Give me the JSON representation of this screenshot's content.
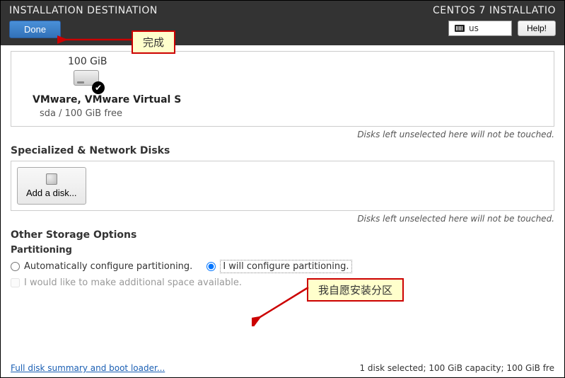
{
  "header": {
    "title": "INSTALLATION DESTINATION",
    "done_label": "Done",
    "installer_title": "CENTOS 7 INSTALLATIO",
    "keyboard_layout": "us",
    "help_label": "Help!"
  },
  "local_disks": {
    "size": "100 GiB",
    "name": "VMware, VMware Virtual S",
    "detail": "sda    /    100 GiB free",
    "note": "Disks left unselected here will not be touched."
  },
  "network_disks": {
    "section_title": "Specialized & Network Disks",
    "add_label": "Add a disk...",
    "note": "Disks left unselected here will not be touched."
  },
  "storage_options": {
    "section_title": "Other Storage Options",
    "partitioning_subtitle": "Partitioning",
    "auto_label": "Automatically configure partitioning.",
    "manual_label": "I will configure partitioning.",
    "reclaim_label": "I would like to make additional space available."
  },
  "footer": {
    "link": "Full disk summary and boot loader...",
    "status": "1 disk selected; 100 GiB capacity; 100 GiB fre"
  },
  "annotations": {
    "done": "完成",
    "manual_partition": "我自愿安装分区"
  }
}
